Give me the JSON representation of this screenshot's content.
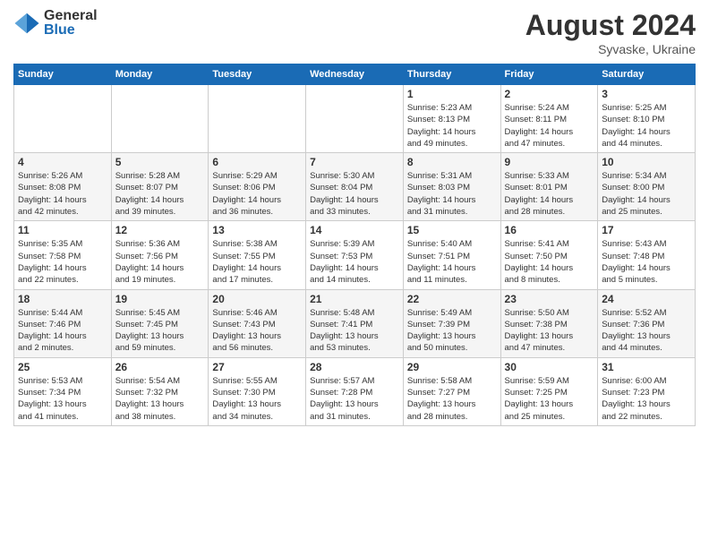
{
  "header": {
    "logo_general": "General",
    "logo_blue": "Blue",
    "month_year": "August 2024",
    "location": "Syvaske, Ukraine"
  },
  "weekdays": [
    "Sunday",
    "Monday",
    "Tuesday",
    "Wednesday",
    "Thursday",
    "Friday",
    "Saturday"
  ],
  "weeks": [
    [
      {
        "day": "",
        "info": ""
      },
      {
        "day": "",
        "info": ""
      },
      {
        "day": "",
        "info": ""
      },
      {
        "day": "",
        "info": ""
      },
      {
        "day": "1",
        "info": "Sunrise: 5:23 AM\nSunset: 8:13 PM\nDaylight: 14 hours\nand 49 minutes."
      },
      {
        "day": "2",
        "info": "Sunrise: 5:24 AM\nSunset: 8:11 PM\nDaylight: 14 hours\nand 47 minutes."
      },
      {
        "day": "3",
        "info": "Sunrise: 5:25 AM\nSunset: 8:10 PM\nDaylight: 14 hours\nand 44 minutes."
      }
    ],
    [
      {
        "day": "4",
        "info": "Sunrise: 5:26 AM\nSunset: 8:08 PM\nDaylight: 14 hours\nand 42 minutes."
      },
      {
        "day": "5",
        "info": "Sunrise: 5:28 AM\nSunset: 8:07 PM\nDaylight: 14 hours\nand 39 minutes."
      },
      {
        "day": "6",
        "info": "Sunrise: 5:29 AM\nSunset: 8:06 PM\nDaylight: 14 hours\nand 36 minutes."
      },
      {
        "day": "7",
        "info": "Sunrise: 5:30 AM\nSunset: 8:04 PM\nDaylight: 14 hours\nand 33 minutes."
      },
      {
        "day": "8",
        "info": "Sunrise: 5:31 AM\nSunset: 8:03 PM\nDaylight: 14 hours\nand 31 minutes."
      },
      {
        "day": "9",
        "info": "Sunrise: 5:33 AM\nSunset: 8:01 PM\nDaylight: 14 hours\nand 28 minutes."
      },
      {
        "day": "10",
        "info": "Sunrise: 5:34 AM\nSunset: 8:00 PM\nDaylight: 14 hours\nand 25 minutes."
      }
    ],
    [
      {
        "day": "11",
        "info": "Sunrise: 5:35 AM\nSunset: 7:58 PM\nDaylight: 14 hours\nand 22 minutes."
      },
      {
        "day": "12",
        "info": "Sunrise: 5:36 AM\nSunset: 7:56 PM\nDaylight: 14 hours\nand 19 minutes."
      },
      {
        "day": "13",
        "info": "Sunrise: 5:38 AM\nSunset: 7:55 PM\nDaylight: 14 hours\nand 17 minutes."
      },
      {
        "day": "14",
        "info": "Sunrise: 5:39 AM\nSunset: 7:53 PM\nDaylight: 14 hours\nand 14 minutes."
      },
      {
        "day": "15",
        "info": "Sunrise: 5:40 AM\nSunset: 7:51 PM\nDaylight: 14 hours\nand 11 minutes."
      },
      {
        "day": "16",
        "info": "Sunrise: 5:41 AM\nSunset: 7:50 PM\nDaylight: 14 hours\nand 8 minutes."
      },
      {
        "day": "17",
        "info": "Sunrise: 5:43 AM\nSunset: 7:48 PM\nDaylight: 14 hours\nand 5 minutes."
      }
    ],
    [
      {
        "day": "18",
        "info": "Sunrise: 5:44 AM\nSunset: 7:46 PM\nDaylight: 14 hours\nand 2 minutes."
      },
      {
        "day": "19",
        "info": "Sunrise: 5:45 AM\nSunset: 7:45 PM\nDaylight: 13 hours\nand 59 minutes."
      },
      {
        "day": "20",
        "info": "Sunrise: 5:46 AM\nSunset: 7:43 PM\nDaylight: 13 hours\nand 56 minutes."
      },
      {
        "day": "21",
        "info": "Sunrise: 5:48 AM\nSunset: 7:41 PM\nDaylight: 13 hours\nand 53 minutes."
      },
      {
        "day": "22",
        "info": "Sunrise: 5:49 AM\nSunset: 7:39 PM\nDaylight: 13 hours\nand 50 minutes."
      },
      {
        "day": "23",
        "info": "Sunrise: 5:50 AM\nSunset: 7:38 PM\nDaylight: 13 hours\nand 47 minutes."
      },
      {
        "day": "24",
        "info": "Sunrise: 5:52 AM\nSunset: 7:36 PM\nDaylight: 13 hours\nand 44 minutes."
      }
    ],
    [
      {
        "day": "25",
        "info": "Sunrise: 5:53 AM\nSunset: 7:34 PM\nDaylight: 13 hours\nand 41 minutes."
      },
      {
        "day": "26",
        "info": "Sunrise: 5:54 AM\nSunset: 7:32 PM\nDaylight: 13 hours\nand 38 minutes."
      },
      {
        "day": "27",
        "info": "Sunrise: 5:55 AM\nSunset: 7:30 PM\nDaylight: 13 hours\nand 34 minutes."
      },
      {
        "day": "28",
        "info": "Sunrise: 5:57 AM\nSunset: 7:28 PM\nDaylight: 13 hours\nand 31 minutes."
      },
      {
        "day": "29",
        "info": "Sunrise: 5:58 AM\nSunset: 7:27 PM\nDaylight: 13 hours\nand 28 minutes."
      },
      {
        "day": "30",
        "info": "Sunrise: 5:59 AM\nSunset: 7:25 PM\nDaylight: 13 hours\nand 25 minutes."
      },
      {
        "day": "31",
        "info": "Sunrise: 6:00 AM\nSunset: 7:23 PM\nDaylight: 13 hours\nand 22 minutes."
      }
    ]
  ]
}
